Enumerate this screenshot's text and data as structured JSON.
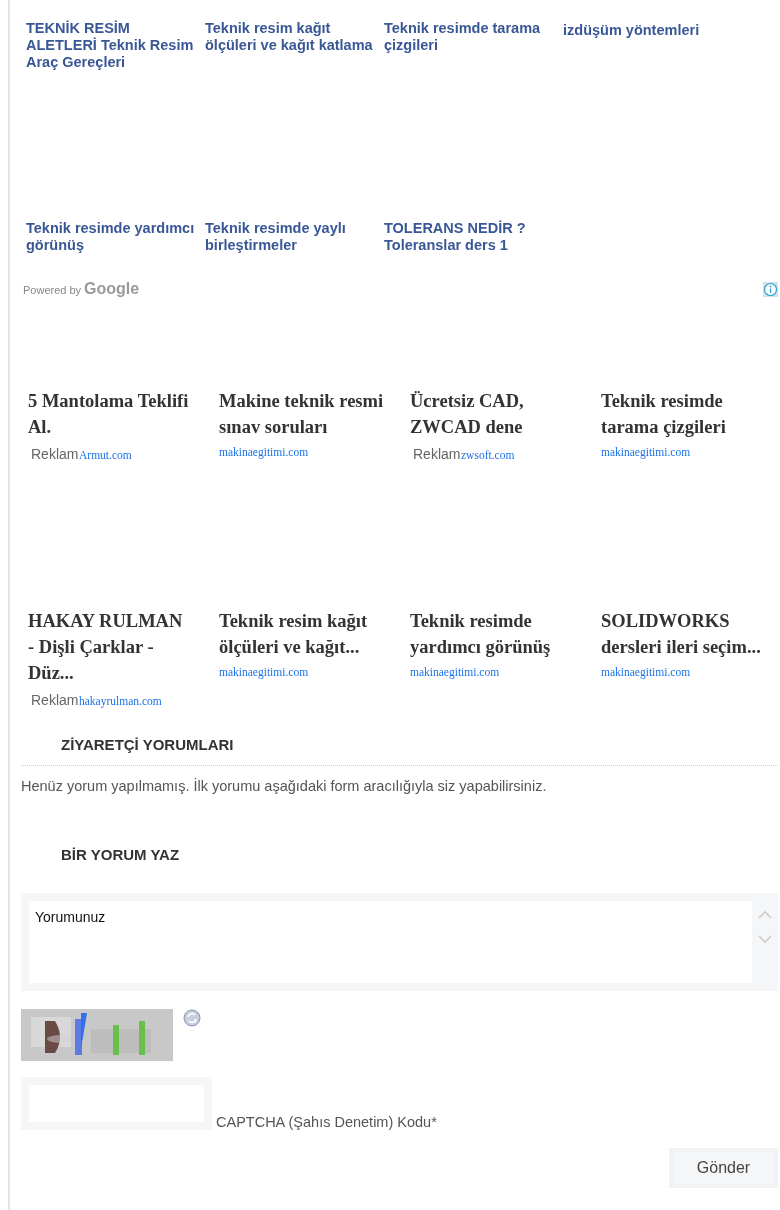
{
  "related_links": [
    {
      "title": "TEKNİK RESİM ALETLERİ Teknik Resim Araç Gereçleri"
    },
    {
      "title": "Teknik resim kağıt ölçüleri ve kağıt katlama"
    },
    {
      "title": "Teknik resimde tarama çizgileri"
    },
    {
      "title": "izdüşüm yöntemleri"
    },
    {
      "title": "Teknik resimde yardımcı görünüş"
    },
    {
      "title": "Teknik resimde yaylı birleştirmeler"
    },
    {
      "title": "TOLERANS NEDİR ? Toleranslar ders 1"
    }
  ],
  "powered_by": "Powered by",
  "powered_brand": "Google",
  "ads": [
    {
      "title": "5 Mantolama Teklifi Al.",
      "label": "Reklam",
      "domain": "Armut.com"
    },
    {
      "title": "Makine teknik resmi sınav soruları",
      "domain": "makinaegitimi.com"
    },
    {
      "title": "Ücretsiz CAD, ZWCAD dene",
      "label": "Reklam",
      "domain": "zwsoft.com"
    },
    {
      "title": "Teknik resimde tarama çizgileri",
      "domain": "makinaegitimi.com"
    },
    {
      "title": "HAKAY RULMAN - Dişli Çarklar - Düz...",
      "label": "Reklam",
      "domain": "hakayrulman.com"
    },
    {
      "title": "Teknik resim kağıt ölçüleri ve kağıt...",
      "domain": "makinaegitimi.com"
    },
    {
      "title": "Teknik resimde yardımcı görünüş",
      "domain": "makinaegitimi.com"
    },
    {
      "title": "SOLIDWORKS dersleri ileri seçim...",
      "domain": "makinaegitimi.com"
    }
  ],
  "comments": {
    "heading": "ZİYARETÇİ YORUMLARI",
    "empty_text": "Henüz yorum yapılmamış. İlk yorumu aşağıdaki form aracılığıyla siz yapabilirsiniz."
  },
  "comment_form": {
    "heading": "BİR YORUM YAZ",
    "comment_field": {
      "placeholder": "Yorumunuz"
    },
    "captcha_field": {
      "label": "CAPTCHA (Şahıs Denetim) Kodu*"
    },
    "submit": "Gönder"
  }
}
